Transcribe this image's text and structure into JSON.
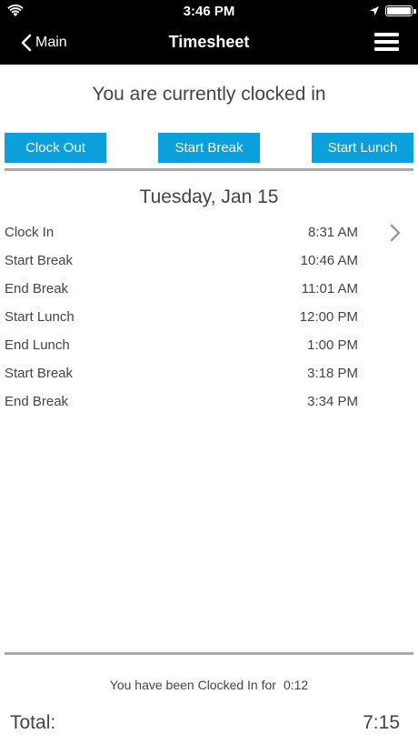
{
  "status_bar": {
    "time": "3:46 PM",
    "icons": [
      "wifi-icon",
      "location-arrow-icon",
      "battery-icon"
    ]
  },
  "nav": {
    "back_label": "Main",
    "title": "Timesheet",
    "menu_icon": "hamburger-menu-icon"
  },
  "headline": "You are currently clocked in",
  "actions": {
    "clock_out": "Clock Out",
    "start_break": "Start Break",
    "start_lunch": "Start Lunch"
  },
  "day": {
    "date": "Tuesday, Jan 15",
    "entries": [
      {
        "label": "Clock In",
        "time": "8:31 AM"
      },
      {
        "label": "Start Break",
        "time": "10:46 AM"
      },
      {
        "label": "End Break",
        "time": "11:01 AM"
      },
      {
        "label": "Start Lunch",
        "time": "12:00 PM"
      },
      {
        "label": "End Lunch",
        "time": "1:00 PM"
      },
      {
        "label": "Start Break",
        "time": "3:18 PM"
      },
      {
        "label": "End Break",
        "time": "3:34 PM"
      }
    ]
  },
  "footer": {
    "clocked_in_text": "You have been Clocked In for",
    "clocked_in_duration": "0:12",
    "total_label": "Total:",
    "total_value": "7:15"
  },
  "colors": {
    "accent": "#0b9fdb",
    "bar_background": "#000000",
    "divider": "#a9a9a9"
  }
}
